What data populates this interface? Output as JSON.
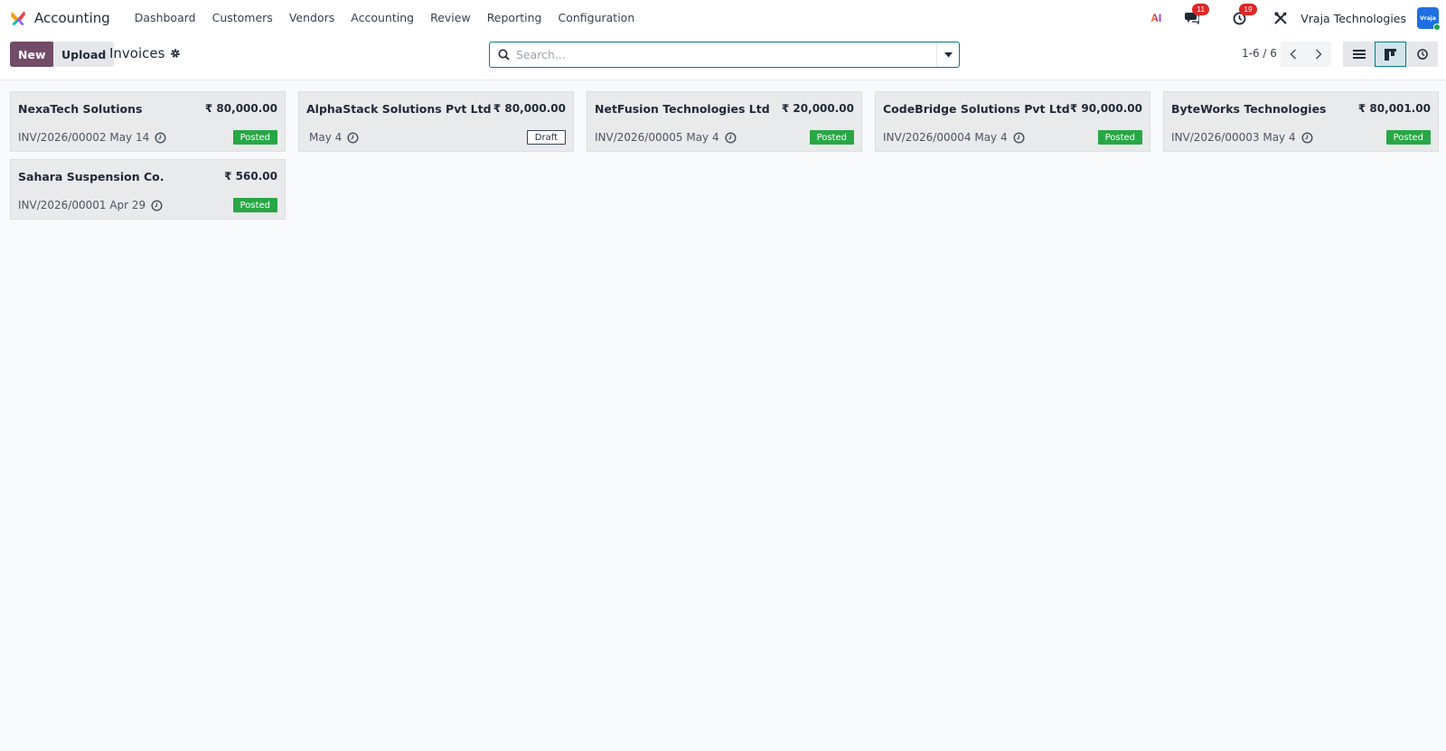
{
  "app": {
    "name": "Accounting"
  },
  "nav": {
    "items": [
      "Dashboard",
      "Customers",
      "Vendors",
      "Accounting",
      "Review",
      "Reporting",
      "Configuration"
    ]
  },
  "systray": {
    "ai_label": "AI",
    "messages_count": "11",
    "activities_count": "19",
    "company": "Vraja Technologies",
    "avatar_text": "Vraja"
  },
  "toolbar": {
    "new_label": "New",
    "upload_label": "Upload",
    "breadcrumb": "Invoices"
  },
  "search": {
    "placeholder": "Search...",
    "value": ""
  },
  "pager": {
    "text": "1-6 / 6"
  },
  "views": [
    "list",
    "kanban",
    "activity"
  ],
  "active_view": "kanban",
  "colors": {
    "brand": "#714b67",
    "accent": "#017e84",
    "posted": "#28a745",
    "badge": "#dc2626"
  },
  "invoices": [
    {
      "partner": "NexaTech Solutions",
      "amount": "₹ 80,000.00",
      "ref": "INV/2026/00002 May 14",
      "status": "Posted"
    },
    {
      "partner": "AlphaStack Solutions Pvt Ltd",
      "amount": "₹ 80,000.00",
      "ref": "May 4",
      "status": "Draft"
    },
    {
      "partner": "NetFusion Technologies Ltd",
      "amount": "₹ 20,000.00",
      "ref": "INV/2026/00005 May 4",
      "status": "Posted"
    },
    {
      "partner": "CodeBridge Solutions Pvt Ltd",
      "amount": "₹ 90,000.00",
      "ref": "INV/2026/00004 May 4",
      "status": "Posted"
    },
    {
      "partner": "ByteWorks Technologies",
      "amount": "₹ 80,001.00",
      "ref": "INV/2026/00003 May 4",
      "status": "Posted"
    },
    {
      "partner": "Sahara Suspension Co.",
      "amount": "₹ 560.00",
      "ref": "INV/2026/00001 Apr 29",
      "status": "Posted"
    }
  ]
}
